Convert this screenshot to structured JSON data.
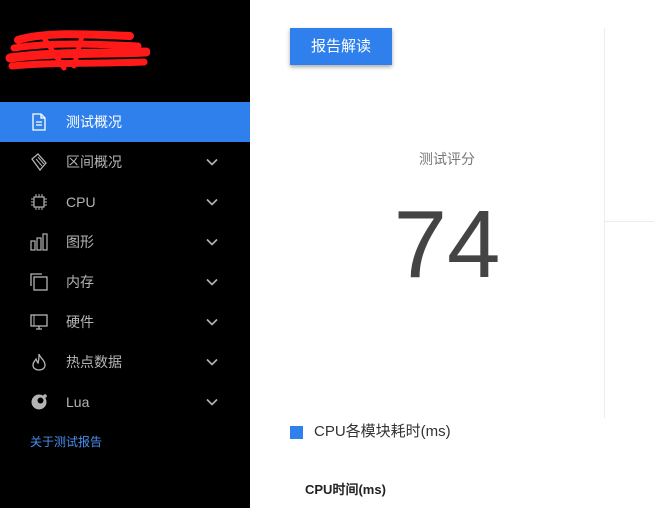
{
  "sidebar": {
    "logo_redaction_color": "#ff1a1a",
    "menu": [
      {
        "label": "测试概况",
        "icon": "document-icon",
        "active": true,
        "has_chevron": false
      },
      {
        "label": "区间概况",
        "icon": "tag-icon",
        "active": false,
        "has_chevron": true
      },
      {
        "label": "CPU",
        "icon": "cpu-chip-icon",
        "active": false,
        "has_chevron": true
      },
      {
        "label": "图形",
        "icon": "bar-chart-icon",
        "active": false,
        "has_chevron": true
      },
      {
        "label": "内存",
        "icon": "copy-pages-icon",
        "active": false,
        "has_chevron": true
      },
      {
        "label": "硬件",
        "icon": "monitor-icon",
        "active": false,
        "has_chevron": true
      },
      {
        "label": "热点数据",
        "icon": "flame-icon",
        "active": false,
        "has_chevron": true
      },
      {
        "label": "Lua",
        "icon": "lua-moon-icon",
        "active": false,
        "has_chevron": true
      }
    ],
    "about_link": "关于测试报告"
  },
  "main": {
    "report_button": "报告解读",
    "score_label": "测试评分",
    "score_value": "74",
    "section_title": "CPU各模块耗时(ms)",
    "sub_title": "CPU时间(ms)"
  },
  "colors": {
    "accent": "#2f80ed",
    "sidebar_bg": "#000000",
    "link": "#4a90f0"
  }
}
